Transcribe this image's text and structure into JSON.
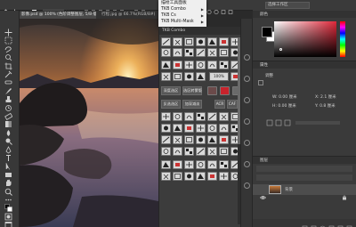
{
  "options_bar": {
    "coords": "16, 6"
  },
  "tabs": [
    {
      "label": "影像.psd @ 100% (色阶调整图层, 5/8-版)",
      "active": true
    },
    {
      "label": "行程.jpg @ 66.7%(RGB/8#)",
      "active": false
    }
  ],
  "menu": {
    "items": [
      {
        "label": "描绘工具面板",
        "has_arrow": false
      },
      {
        "label": "TKB Combo",
        "has_arrow": true
      },
      {
        "label": "TKB Cs",
        "has_arrow": true
      },
      {
        "label": "TKB Multi-Mask",
        "has_arrow": true
      }
    ]
  },
  "tkb_panel": {
    "title": "TKB Combo",
    "buttons": {
      "percent_100": "100%",
      "save_selection": "深度选区",
      "selection_to_mask": "选区转蒙版",
      "inverse_selection": "反选选区",
      "dodge_burn": "加深减淡",
      "acr": "ACR",
      "caf": "CAF"
    }
  },
  "right_panel": {
    "workspace_select": "选择工作区",
    "color_tab": "颜色",
    "properties_tab": "属性",
    "adjustments_label": "调整",
    "field_w": "W: 0.00 厘米",
    "field_h": "H: 0.00 厘米",
    "field_x": "X: 2.1 厘米",
    "field_y": "Y: 0.8 厘米",
    "layers_tab": "图层",
    "layer_name": "背景",
    "colors": {
      "foreground": "#000000",
      "background": "#ffffff",
      "hue_selected": "#e0283a"
    }
  },
  "toolbar": {
    "icons": [
      "move-icon",
      "marquee-icon",
      "lasso-icon",
      "quick-select-icon",
      "crop-icon",
      "eyedropper-icon",
      "healing-icon",
      "brush-icon",
      "clone-stamp-icon",
      "history-brush-icon",
      "eraser-icon",
      "gradient-icon",
      "blur-icon",
      "dodge-icon",
      "pen-icon",
      "type-icon",
      "path-select-icon",
      "rectangle-icon",
      "hand-icon",
      "zoom-icon",
      "more-icon",
      "fg-bg-colors-icon",
      "quick-mask-icon",
      "screen-mode-icon"
    ]
  }
}
